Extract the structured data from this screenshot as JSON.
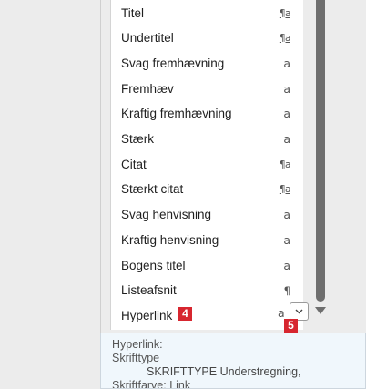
{
  "styles": [
    {
      "name": "Titel",
      "mark": "¶a",
      "type": "para-char"
    },
    {
      "name": "Undertitel",
      "mark": "¶a",
      "type": "para-char"
    },
    {
      "name": "Svag fremhævning",
      "mark": "a",
      "type": "char"
    },
    {
      "name": "Fremhæv",
      "mark": "a",
      "type": "char"
    },
    {
      "name": "Kraftig fremhævning",
      "mark": "a",
      "type": "char"
    },
    {
      "name": "Stærk",
      "mark": "a",
      "type": "char"
    },
    {
      "name": "Citat",
      "mark": "¶a",
      "type": "para-char"
    },
    {
      "name": "Stærkt citat",
      "mark": "¶a",
      "type": "para-char"
    },
    {
      "name": "Svag henvisning",
      "mark": "a",
      "type": "char"
    },
    {
      "name": "Kraftig henvisning",
      "mark": "a",
      "type": "char"
    },
    {
      "name": "Bogens titel",
      "mark": "a",
      "type": "char"
    },
    {
      "name": "Listeafsnit",
      "mark": "¶",
      "type": "para"
    }
  ],
  "hyperlink_item": {
    "name": "Hyperlink",
    "mark": "a"
  },
  "badges": {
    "hyperlink": "4",
    "dropdown": "5"
  },
  "tooltip": {
    "line1": "Hyperlink:",
    "line2": "Skrifttype",
    "line3": "SKRIFTTYPE Understregning,",
    "line4": "Skriftfarve: Link"
  },
  "icons": {
    "dropdown": "chevron-down-icon",
    "scroll": "scroll-down-arrow-icon"
  },
  "colors": {
    "badge": "#d7262f",
    "tooltip_bg": "#f0f7fc",
    "scroll_thumb": "#6e6e6e"
  }
}
